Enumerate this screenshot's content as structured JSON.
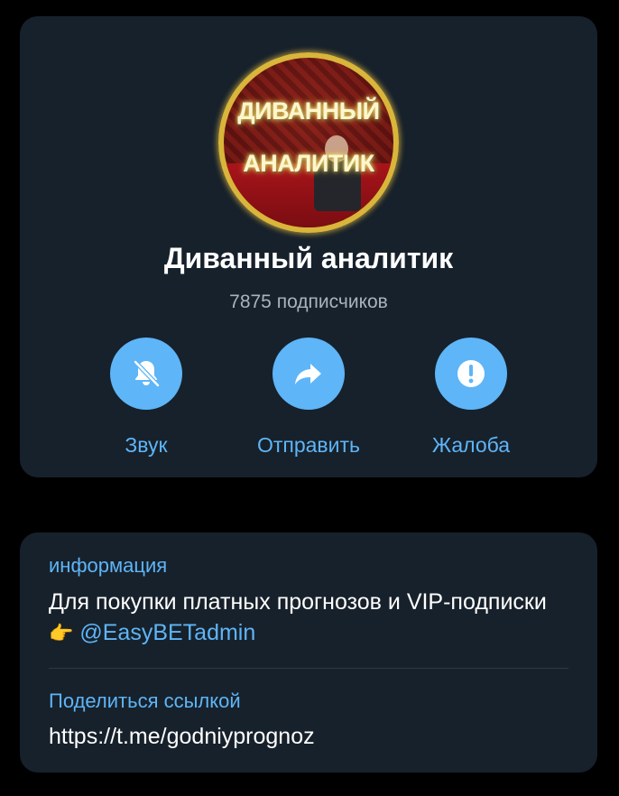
{
  "profile": {
    "avatar_text_line1": "ДИВАННЫЙ",
    "avatar_text_line2": "АНАЛИТИК",
    "title": "Диванный аналитик",
    "subscribers": "7875 подписчиков"
  },
  "actions": [
    {
      "label": "Звук",
      "icon": "bell-muted-icon"
    },
    {
      "label": "Отправить",
      "icon": "share-arrow-icon"
    },
    {
      "label": "Жалоба",
      "icon": "exclamation-icon"
    }
  ],
  "info": {
    "heading": "информация",
    "text_before": "Для покупки платных прогнозов и VIP-подписки",
    "emoji": "👉",
    "mention": "@EasyBETadmin"
  },
  "share": {
    "heading": "Поделиться ссылкой",
    "link": "https://t.me/godniyprognoz"
  },
  "colors": {
    "background": "#000000",
    "card": "#17212b",
    "accent": "#5eb5f7",
    "secondary_text": "#a9b3bd",
    "primary_text": "#ffffff"
  }
}
